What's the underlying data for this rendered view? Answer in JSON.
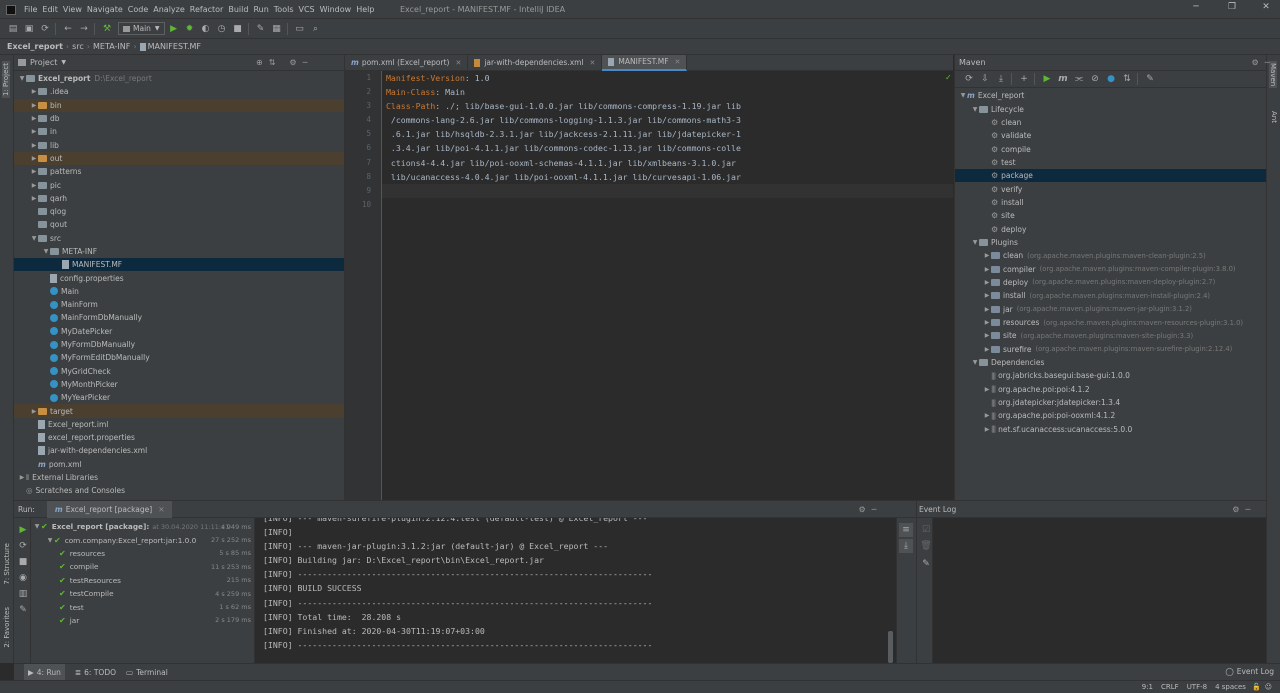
{
  "titlebar": {
    "menu": [
      "File",
      "Edit",
      "View",
      "Navigate",
      "Code",
      "Analyze",
      "Refactor",
      "Build",
      "Run",
      "Tools",
      "VCS",
      "Window",
      "Help"
    ],
    "title": "Excel_report - MANIFEST.MF - IntelliJ IDEA"
  },
  "toolbar": {
    "run_config": "Main"
  },
  "navbar": {
    "crumbs": [
      "Excel_report",
      "src",
      "META-INF",
      "MANIFEST.MF"
    ]
  },
  "left_tool": {
    "project": "1: Project",
    "structure": "7: Structure",
    "favorites": "2: Favorites"
  },
  "right_tool": {
    "maven": "Maven",
    "ant": "Ant"
  },
  "project": {
    "title": "Project",
    "root": {
      "name": "Excel_report",
      "path": "D:\\Excel_report"
    },
    "items": [
      {
        "label": ".idea",
        "depth": 1,
        "kind": "folder",
        "arrow": "▶"
      },
      {
        "label": "bin",
        "depth": 1,
        "kind": "folder-o",
        "arrow": "▶",
        "excl": true
      },
      {
        "label": "db",
        "depth": 1,
        "kind": "folder",
        "arrow": "▶"
      },
      {
        "label": "in",
        "depth": 1,
        "kind": "folder",
        "arrow": "▶"
      },
      {
        "label": "lib",
        "depth": 1,
        "kind": "folder",
        "arrow": "▶"
      },
      {
        "label": "out",
        "depth": 1,
        "kind": "folder-o",
        "arrow": "▶",
        "excl": true
      },
      {
        "label": "patterns",
        "depth": 1,
        "kind": "folder",
        "arrow": "▶"
      },
      {
        "label": "pic",
        "depth": 1,
        "kind": "folder",
        "arrow": "▶"
      },
      {
        "label": "qarh",
        "depth": 1,
        "kind": "folder",
        "arrow": "▶"
      },
      {
        "label": "qlog",
        "depth": 1,
        "kind": "folder",
        "arrow": ""
      },
      {
        "label": "qout",
        "depth": 1,
        "kind": "folder",
        "arrow": ""
      },
      {
        "label": "src",
        "depth": 1,
        "kind": "folder",
        "arrow": "▼"
      },
      {
        "label": "META-INF",
        "depth": 2,
        "kind": "folder",
        "arrow": "▼"
      },
      {
        "label": "MANIFEST.MF",
        "depth": 3,
        "kind": "file",
        "arrow": "",
        "sel": true
      },
      {
        "label": "config.properties",
        "depth": 2,
        "kind": "file",
        "arrow": ""
      },
      {
        "label": "Main",
        "depth": 2,
        "kind": "class",
        "arrow": ""
      },
      {
        "label": "MainForm",
        "depth": 2,
        "kind": "class",
        "arrow": ""
      },
      {
        "label": "MainFormDbManually",
        "depth": 2,
        "kind": "class",
        "arrow": ""
      },
      {
        "label": "MyDatePicker",
        "depth": 2,
        "kind": "class",
        "arrow": ""
      },
      {
        "label": "MyFormDbManually",
        "depth": 2,
        "kind": "class",
        "arrow": ""
      },
      {
        "label": "MyFormEditDbManually",
        "depth": 2,
        "kind": "class",
        "arrow": ""
      },
      {
        "label": "MyGridCheck",
        "depth": 2,
        "kind": "class",
        "arrow": ""
      },
      {
        "label": "MyMonthPicker",
        "depth": 2,
        "kind": "class",
        "arrow": ""
      },
      {
        "label": "MyYearPicker",
        "depth": 2,
        "kind": "class",
        "arrow": ""
      },
      {
        "label": "target",
        "depth": 1,
        "kind": "folder-o",
        "arrow": "▶",
        "excl": true
      },
      {
        "label": "Excel_report.iml",
        "depth": 1,
        "kind": "file",
        "arrow": ""
      },
      {
        "label": "excel_report.properties",
        "depth": 1,
        "kind": "file",
        "arrow": ""
      },
      {
        "label": "jar-with-dependencies.xml",
        "depth": 1,
        "kind": "file",
        "arrow": ""
      },
      {
        "label": "pom.xml",
        "depth": 1,
        "kind": "mfile",
        "arrow": ""
      },
      {
        "label": "External Libraries",
        "depth": 0,
        "kind": "lib",
        "arrow": "▶"
      },
      {
        "label": "Scratches and Consoles",
        "depth": 0,
        "kind": "scratch",
        "arrow": ""
      }
    ]
  },
  "editor": {
    "tabs": [
      {
        "label": "pom.xml (Excel_report)",
        "active": false
      },
      {
        "label": "jar-with-dependencies.xml",
        "active": false
      },
      {
        "label": "MANIFEST.MF",
        "active": true
      }
    ],
    "line_numbers": [
      "1",
      "2",
      "3",
      "4",
      "5",
      "6",
      "7",
      "8",
      "9",
      "10"
    ],
    "lines": [
      {
        "key": "Manifest-Version",
        "val": ": 1.0"
      },
      {
        "key": "Main-Class",
        "val": ": Main"
      },
      {
        "key": "Class-Path",
        "val": ": ./; lib/base-gui-1.0.0.jar lib/commons-compress-1.19.jar lib"
      },
      {
        "key": "",
        "val": " /commons-lang-2.6.jar lib/commons-logging-1.1.3.jar lib/commons-math3-3"
      },
      {
        "key": "",
        "val": " .6.1.jar lib/hsqldb-2.3.1.jar lib/jackcess-2.1.11.jar lib/jdatepicker-1"
      },
      {
        "key": "",
        "val": " .3.4.jar lib/poi-4.1.1.jar lib/commons-codec-1.13.jar lib/commons-colle"
      },
      {
        "key": "",
        "val": " ctions4-4.4.jar lib/poi-ooxml-schemas-4.1.1.jar lib/xmlbeans-3.1.0.jar"
      },
      {
        "key": "",
        "val": " lib/ucanaccess-4.0.4.jar lib/poi-ooxml-4.1.1.jar lib/curvesapi-1.06.jar"
      },
      {
        "key": "",
        "val": ""
      },
      {
        "key": "",
        "val": ""
      }
    ]
  },
  "maven": {
    "title": "Maven",
    "items": [
      {
        "label": "Excel_report",
        "depth": 0,
        "arrow": "▼",
        "icon": "m",
        "note": ""
      },
      {
        "label": "Lifecycle",
        "depth": 1,
        "arrow": "▼",
        "icon": "folder",
        "note": ""
      },
      {
        "label": "clean",
        "depth": 2,
        "arrow": "",
        "icon": "gear",
        "note": ""
      },
      {
        "label": "validate",
        "depth": 2,
        "arrow": "",
        "icon": "gear",
        "note": ""
      },
      {
        "label": "compile",
        "depth": 2,
        "arrow": "",
        "icon": "gear",
        "note": ""
      },
      {
        "label": "test",
        "depth": 2,
        "arrow": "",
        "icon": "gear",
        "note": ""
      },
      {
        "label": "package",
        "depth": 2,
        "arrow": "",
        "icon": "gear",
        "note": "",
        "sel": true
      },
      {
        "label": "verify",
        "depth": 2,
        "arrow": "",
        "icon": "gear",
        "note": ""
      },
      {
        "label": "install",
        "depth": 2,
        "arrow": "",
        "icon": "gear",
        "note": ""
      },
      {
        "label": "site",
        "depth": 2,
        "arrow": "",
        "icon": "gear",
        "note": ""
      },
      {
        "label": "deploy",
        "depth": 2,
        "arrow": "",
        "icon": "gear",
        "note": ""
      },
      {
        "label": "Plugins",
        "depth": 1,
        "arrow": "▼",
        "icon": "folder",
        "note": ""
      },
      {
        "label": "clean",
        "depth": 2,
        "arrow": "▶",
        "icon": "plugin",
        "note": "(org.apache.maven.plugins:maven-clean-plugin:2.5)"
      },
      {
        "label": "compiler",
        "depth": 2,
        "arrow": "▶",
        "icon": "plugin",
        "note": "(org.apache.maven.plugins:maven-compiler-plugin:3.8.0)"
      },
      {
        "label": "deploy",
        "depth": 2,
        "arrow": "▶",
        "icon": "plugin",
        "note": "(org.apache.maven.plugins:maven-deploy-plugin:2.7)"
      },
      {
        "label": "install",
        "depth": 2,
        "arrow": "▶",
        "icon": "plugin",
        "note": "(org.apache.maven.plugins:maven-install-plugin:2.4)"
      },
      {
        "label": "jar",
        "depth": 2,
        "arrow": "▶",
        "icon": "plugin",
        "note": "(org.apache.maven.plugins:maven-jar-plugin:3.1.2)"
      },
      {
        "label": "resources",
        "depth": 2,
        "arrow": "▶",
        "icon": "plugin",
        "note": "(org.apache.maven.plugins:maven-resources-plugin:3.1.0)"
      },
      {
        "label": "site",
        "depth": 2,
        "arrow": "▶",
        "icon": "plugin",
        "note": "(org.apache.maven.plugins:maven-site-plugin:3.3)"
      },
      {
        "label": "surefire",
        "depth": 2,
        "arrow": "▶",
        "icon": "plugin",
        "note": "(org.apache.maven.plugins:maven-surefire-plugin:2.12.4)"
      },
      {
        "label": "Dependencies",
        "depth": 1,
        "arrow": "▼",
        "icon": "folder",
        "note": ""
      },
      {
        "label": "org.jabricks.basegui:base-gui:1.0.0",
        "depth": 2,
        "arrow": "",
        "icon": "lib",
        "note": ""
      },
      {
        "label": "org.apache.poi:poi:4.1.2",
        "depth": 2,
        "arrow": "▶",
        "icon": "lib",
        "note": ""
      },
      {
        "label": "org.jdatepicker:jdatepicker:1.3.4",
        "depth": 2,
        "arrow": "",
        "icon": "lib",
        "note": ""
      },
      {
        "label": "org.apache.poi:poi-ooxml:4.1.2",
        "depth": 2,
        "arrow": "▶",
        "icon": "lib",
        "note": ""
      },
      {
        "label": "net.sf.ucanaccess:ucanaccess:5.0.0",
        "depth": 2,
        "arrow": "▶",
        "icon": "lib",
        "note": ""
      }
    ]
  },
  "run": {
    "label": "Run:",
    "tab": "Excel_report [package]",
    "tree": [
      {
        "label": "Excel_report [package]:",
        "note": "at 30.04.2020 11:11:41",
        "time": "s 949 ms",
        "depth": 0,
        "bold": true
      },
      {
        "label": "com.company:Excel_report:jar:1.0.0",
        "note": "",
        "time": "27 s 252 ms",
        "depth": 1
      },
      {
        "label": "resources",
        "note": "",
        "time": "5 s 85 ms",
        "depth": 2
      },
      {
        "label": "compile",
        "note": "",
        "time": "11 s 253 ms",
        "depth": 2
      },
      {
        "label": "testResources",
        "note": "",
        "time": "215 ms",
        "depth": 2
      },
      {
        "label": "testCompile",
        "note": "",
        "time": "4 s 259 ms",
        "depth": 2
      },
      {
        "label": "test",
        "note": "",
        "time": "1 s 62 ms",
        "depth": 2
      },
      {
        "label": "jar",
        "note": "",
        "time": "2 s 179 ms",
        "depth": 2
      }
    ],
    "console": [
      "[INFO] --- maven-surefire-plugin:2.12.4:test (default-test) @ Excel_report ---",
      "[INFO]",
      "[INFO] --- maven-jar-plugin:3.1.2:jar (default-jar) @ Excel_report ---",
      "[INFO] Building jar: D:\\Excel_report\\bin\\Excel_report.jar",
      "[INFO] ------------------------------------------------------------------------",
      "[INFO] BUILD SUCCESS",
      "[INFO] ------------------------------------------------------------------------",
      "[INFO] Total time:  28.208 s",
      "[INFO] Finished at: 2020-04-30T11:19:07+03:00",
      "[INFO] ------------------------------------------------------------------------"
    ]
  },
  "eventlog": {
    "title": "Event Log"
  },
  "bottom_tabs": {
    "run": "4: Run",
    "todo": "6: TODO",
    "terminal": "Terminal",
    "eventlog": "Event Log"
  },
  "status": {
    "position": "9:1",
    "line_sep": "CRLF",
    "encoding": "UTF-8",
    "indent": "4 spaces"
  }
}
